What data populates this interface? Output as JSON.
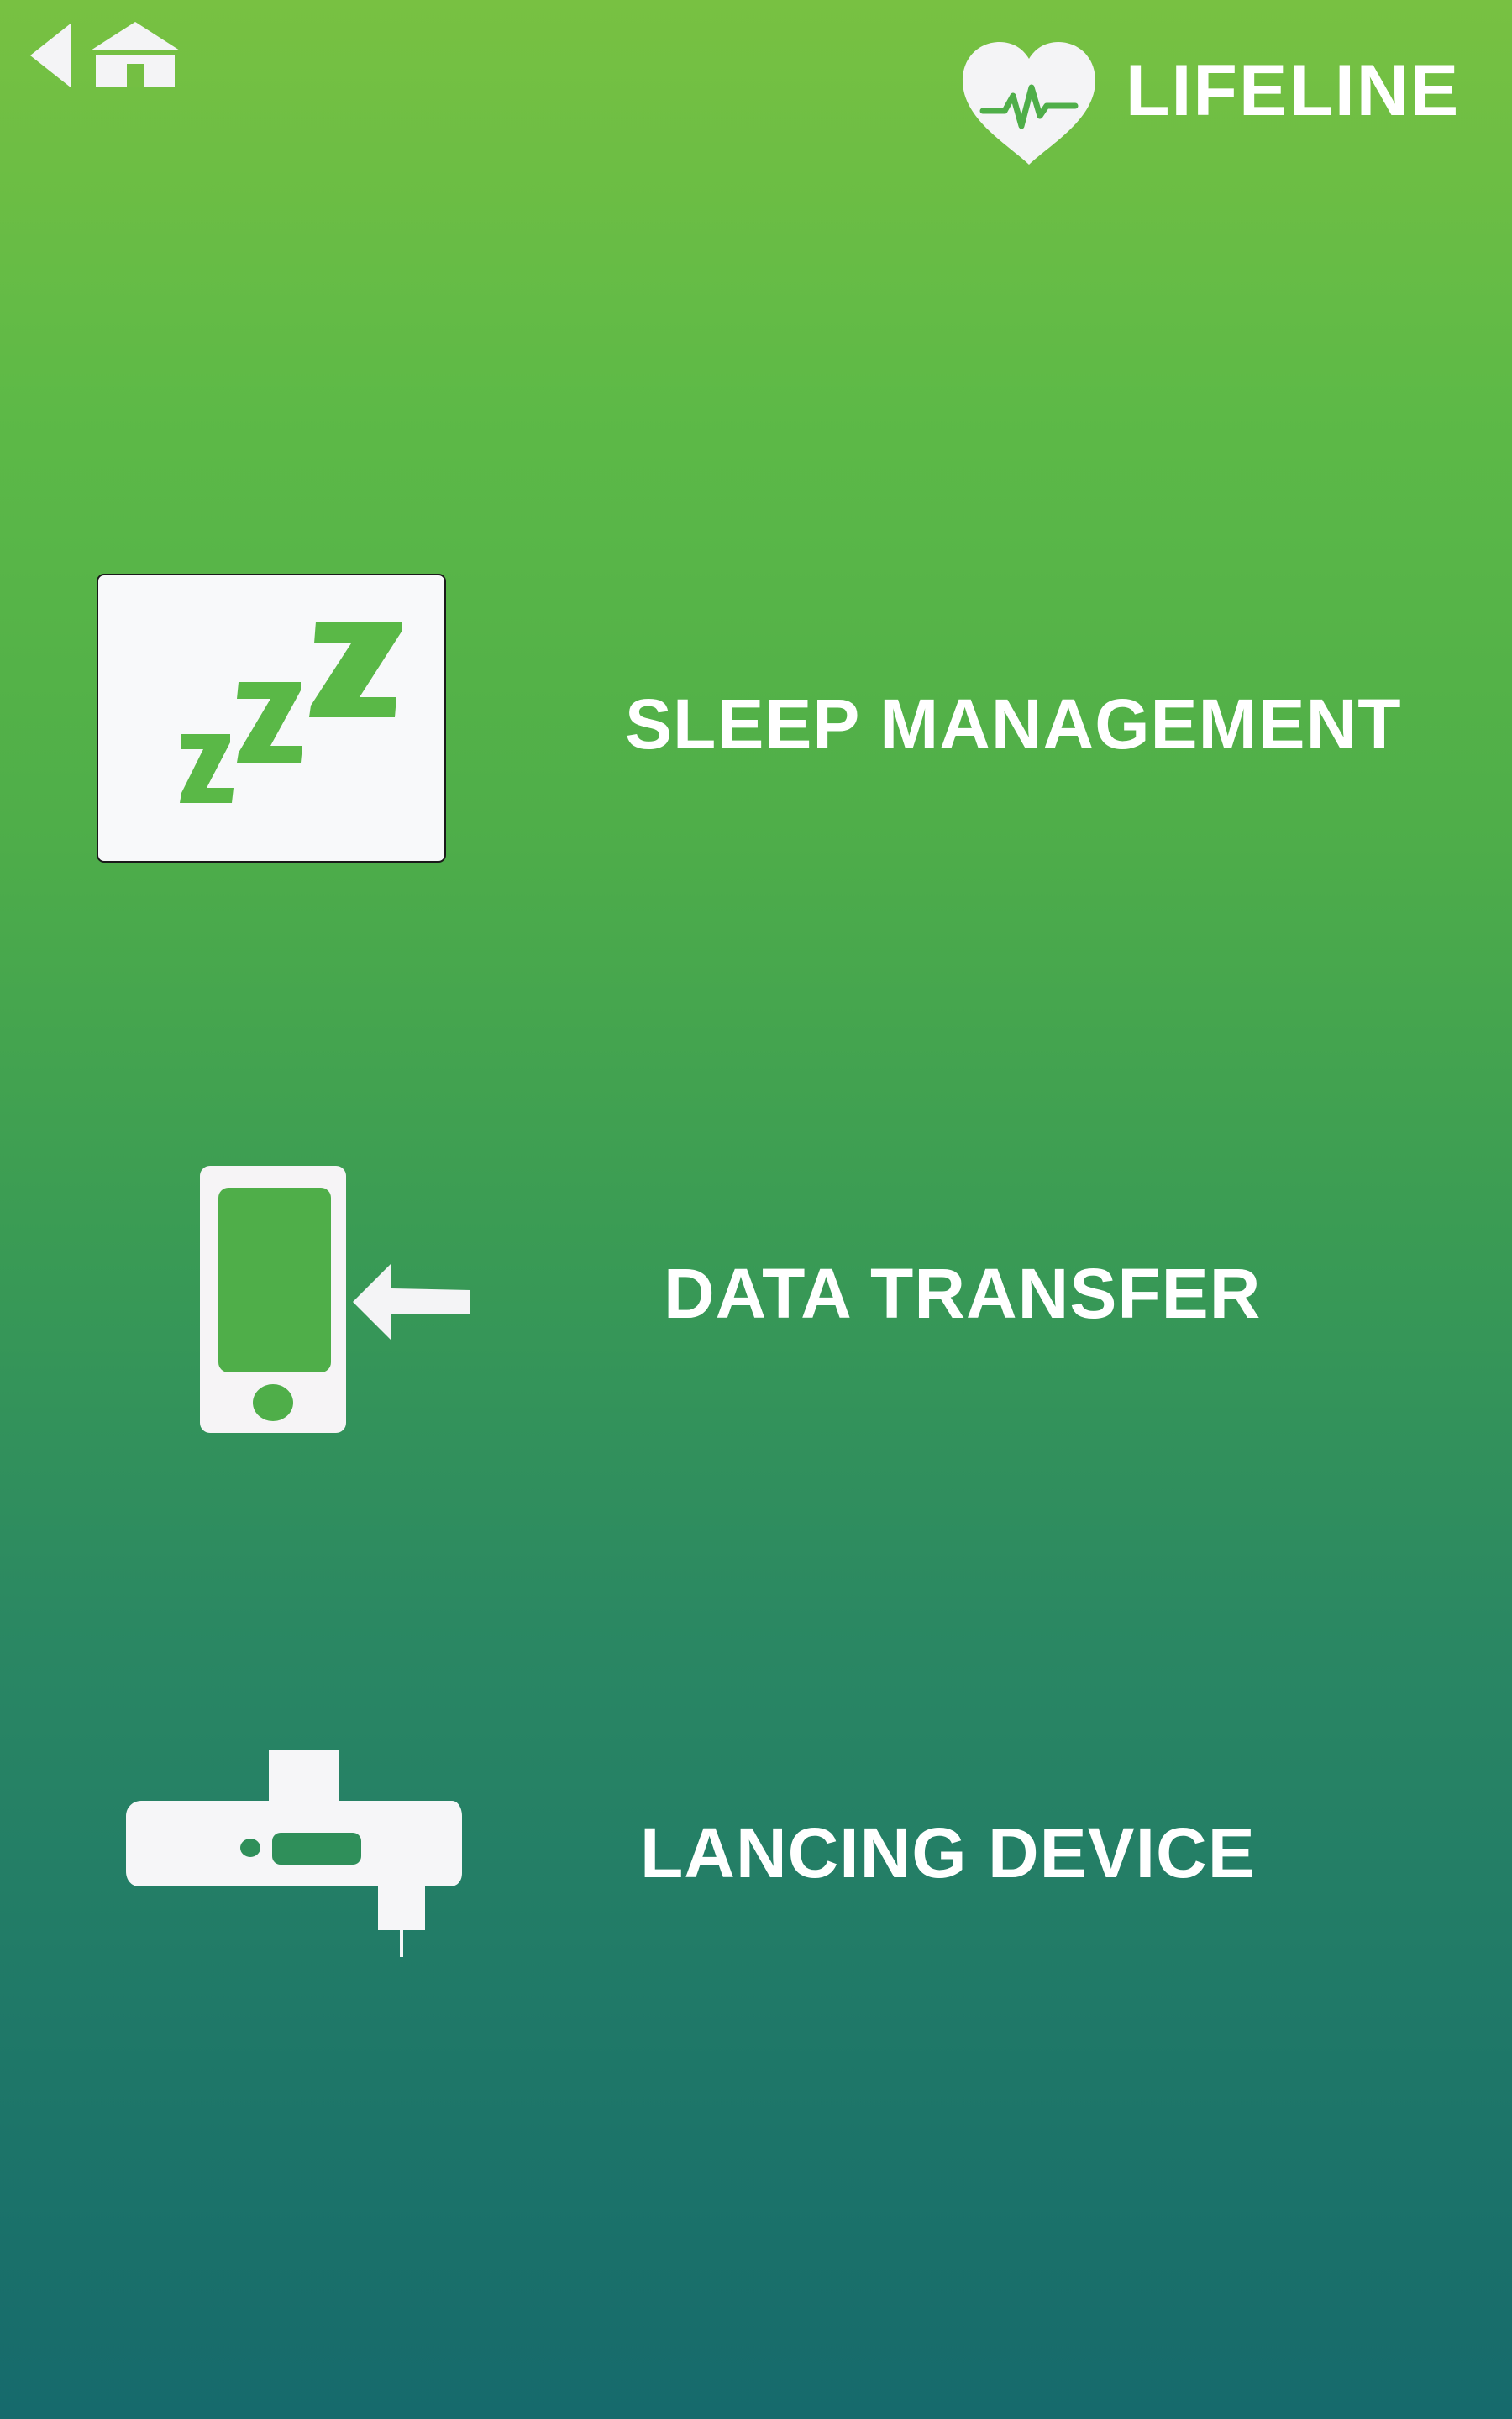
{
  "header": {
    "back_icon": "back-arrow-icon",
    "home_icon": "home-icon",
    "brand_icon": "heart-pulse-icon",
    "brand_title": "LIFELINE"
  },
  "menu": {
    "items": [
      {
        "label": "SLEEP MANAGEMENT",
        "icon": "sleep-zzz-icon"
      },
      {
        "label": "DATA TRANSFER",
        "icon": "phone-transfer-icon"
      },
      {
        "label": "LANCING DEVICE",
        "icon": "lancing-device-icon"
      }
    ]
  },
  "colors": {
    "gradient_top": "#78c142",
    "gradient_bottom": "#166a6c",
    "icon_green": "#5ab847",
    "white": "#ffffff"
  }
}
